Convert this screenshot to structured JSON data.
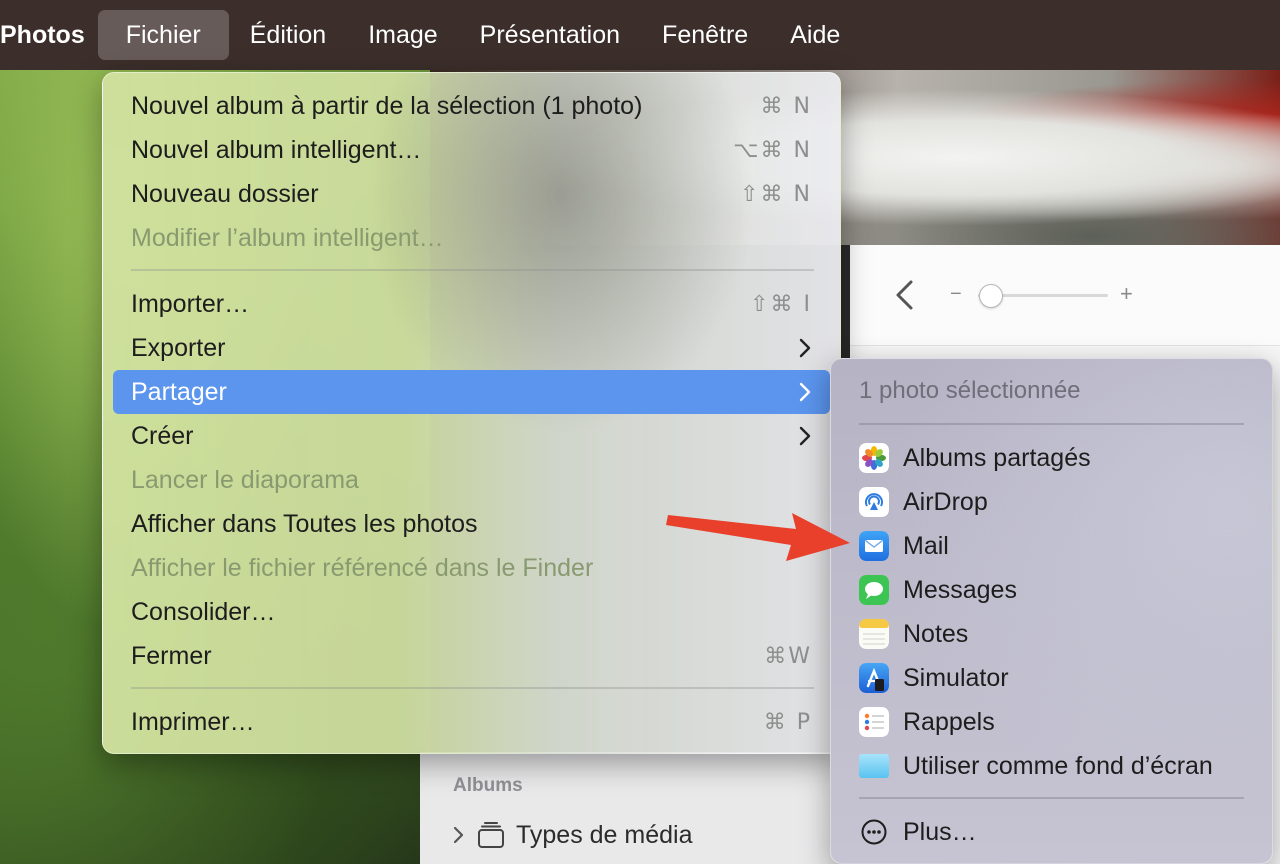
{
  "menubar": {
    "app_name": "Photos",
    "items": [
      "Fichier",
      "Édition",
      "Image",
      "Présentation",
      "Fenêtre",
      "Aide"
    ]
  },
  "file_menu": {
    "items": [
      {
        "label": "Nouvel album à partir de la sélection (1 photo)",
        "shortcut": "⌘ N",
        "enabled": true
      },
      {
        "label": "Nouvel album intelligent…",
        "shortcut": "⌥⌘ N",
        "enabled": true
      },
      {
        "label": "Nouveau dossier",
        "shortcut": "⇧⌘ N",
        "enabled": true
      },
      {
        "label": "Modifier l’album intelligent…",
        "shortcut": "",
        "enabled": false
      },
      {
        "label": "Importer…",
        "shortcut": "⇧⌘ I",
        "enabled": true
      },
      {
        "label": "Exporter",
        "submenu": true,
        "enabled": true
      },
      {
        "label": "Partager",
        "submenu": true,
        "enabled": true,
        "highlighted": true
      },
      {
        "label": "Créer",
        "submenu": true,
        "enabled": true
      },
      {
        "label": "Lancer le diaporama",
        "shortcut": "",
        "enabled": false
      },
      {
        "label": "Afficher dans Toutes les photos",
        "shortcut": "",
        "enabled": true
      },
      {
        "label": "Afficher le fichier référencé dans le Finder",
        "shortcut": "",
        "enabled": false
      },
      {
        "label": "Consolider…",
        "shortcut": "",
        "enabled": true
      },
      {
        "label": "Fermer",
        "shortcut": "⌘W",
        "enabled": true
      },
      {
        "label": "Imprimer…",
        "shortcut": "⌘ P",
        "enabled": true
      }
    ]
  },
  "share_menu": {
    "header": "1 photo sélectionnée",
    "items": [
      {
        "label": "Albums partagés",
        "icon": "shared-albums-icon"
      },
      {
        "label": "AirDrop",
        "icon": "airdrop-icon"
      },
      {
        "label": "Mail",
        "icon": "mail-icon"
      },
      {
        "label": "Messages",
        "icon": "messages-icon"
      },
      {
        "label": "Notes",
        "icon": "notes-icon"
      },
      {
        "label": "Simulator",
        "icon": "simulator-icon"
      },
      {
        "label": "Rappels",
        "icon": "reminders-icon"
      },
      {
        "label": "Utiliser comme fond d’écran",
        "icon": "wallpaper-icon"
      }
    ],
    "more_label": "Plus…"
  },
  "toolbar": {
    "zoom_minus": "−",
    "zoom_plus": "+",
    "zoom_level": 0.0
  },
  "sidebar": {
    "albums_header": "Albums",
    "media_types_label": "Types de média"
  },
  "colors": {
    "highlight": "#5b95ee",
    "annotation_arrow": "#e8402b",
    "menubar": "#3b2e2b"
  }
}
